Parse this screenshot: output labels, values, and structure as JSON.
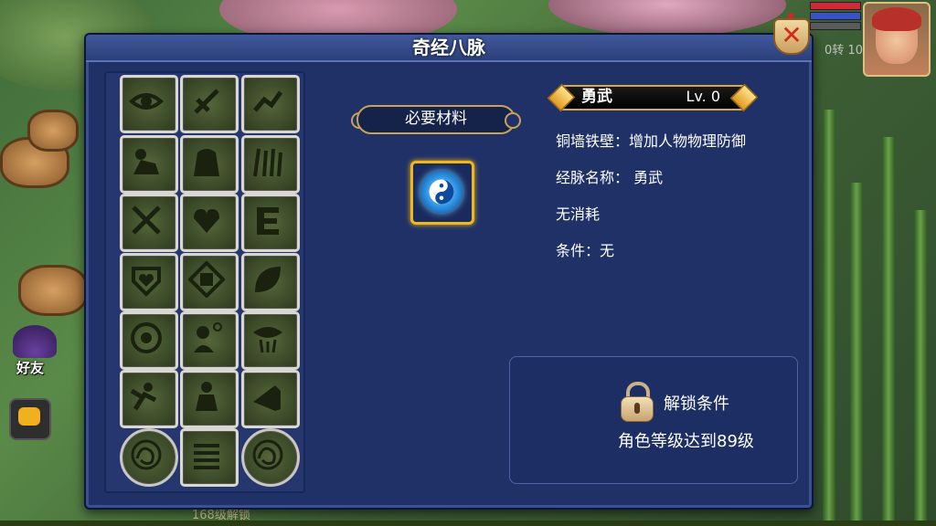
{
  "panel": {
    "title": "奇经八脉",
    "close_icon": "close-x-icon"
  },
  "materials": {
    "label": "必要材料",
    "item_icon": "taiji-orb-icon"
  },
  "meridian": {
    "name": "勇武",
    "level": "Lv. 0",
    "effect": "铜墙铁壁：增加人物物理防御",
    "meridian_name": "经脉名称：  勇武",
    "cost": "无消耗",
    "condition": "条件：无"
  },
  "unlock": {
    "title": "解锁条件",
    "requirement": "角色等级达到89级"
  },
  "hud": {
    "friends_label": "好友",
    "bottom_text": "168级解锁",
    "side_stat": "0转  10"
  },
  "grid_icons": [
    [
      "eye-icon",
      "sword-slash-icon",
      "running-figure-icon"
    ],
    [
      "warrior-riding-icon",
      "rock-icon",
      "grass-icon"
    ],
    [
      "crossed-swords-icon",
      "heart-icon",
      "glyph-e-icon"
    ],
    [
      "shield-heart-icon",
      "brave-seal-icon",
      "leaf-icon"
    ],
    [
      "swirl-icon",
      "thinking-figure-icon",
      "eye-glyph-icon"
    ],
    [
      "fighter-icon",
      "seated-figure-icon",
      "horn-icon"
    ],
    [
      "dragon-coin-icon",
      "stacked-scrolls-icon",
      "dragon-coin-icon"
    ]
  ],
  "colors": {
    "panel_bg": "#1f3166",
    "accent_gold": "#f0b61e",
    "close_red": "#d32a1a"
  }
}
